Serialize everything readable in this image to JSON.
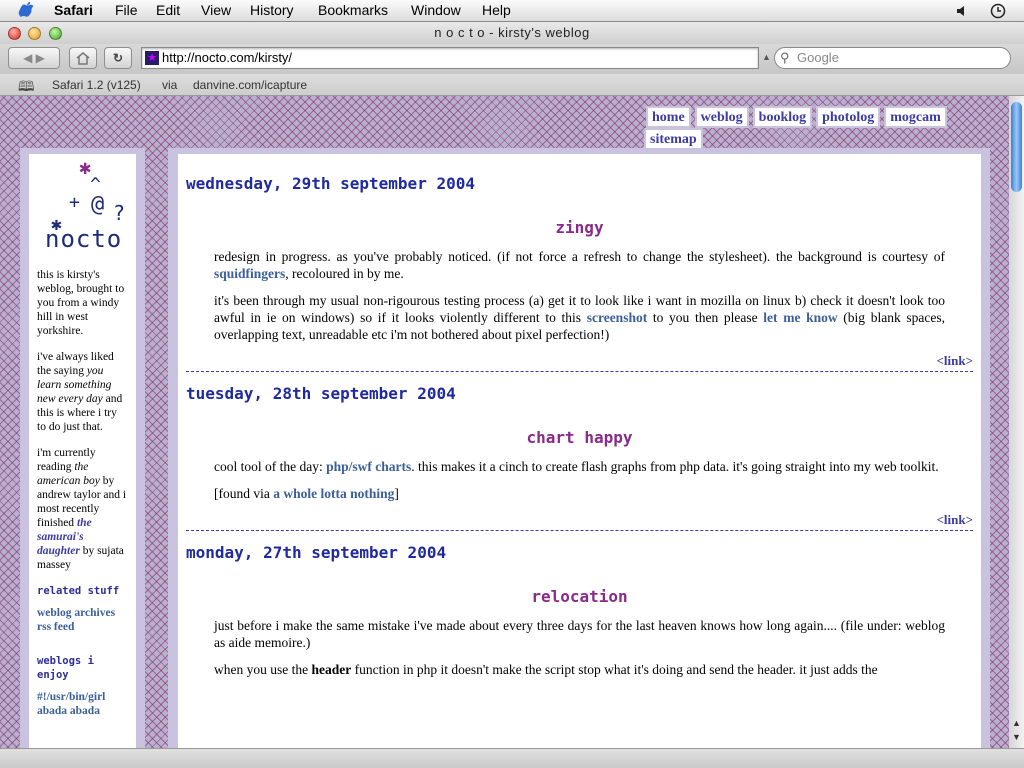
{
  "menubar": {
    "items": [
      "Safari",
      "File",
      "Edit",
      "View",
      "History",
      "Bookmarks",
      "Window",
      "Help"
    ]
  },
  "window": {
    "title": "n o c t o - kirsty's weblog"
  },
  "toolbar": {
    "url": "http://nocto.com/kirsty/",
    "search_placeholder": "Google"
  },
  "bookmarks": {
    "items": [
      "Safari 1.2 (v125)",
      "via",
      "danvine.com/icapture"
    ]
  },
  "nav": {
    "items": [
      "home",
      "weblog",
      "booklog",
      "photolog",
      "mogcam",
      "sitemap"
    ]
  },
  "logo": {
    "text": "nocto"
  },
  "sidebar": {
    "intro": "this is kirsty's weblog, brought to you from a windy hill in west yorkshire.",
    "saying_pre": "i've always liked the saying ",
    "saying_em": "you learn something new every day",
    "saying_post": " and this is where i try to do just that.",
    "reading_pre": "i'm currently reading ",
    "reading_book1": "the american boy",
    "reading_mid": " by andrew taylor and i most recently finished ",
    "reading_book2": "the samurai's daughter",
    "reading_post": " by sujata massey",
    "related_heading": "related stuff",
    "related_links": [
      "weblog archives",
      "rss feed"
    ],
    "weblogs_heading": "weblogs i enjoy",
    "weblogs_links": [
      "#!/usr/bin/girl",
      "abada abada"
    ]
  },
  "posts": [
    {
      "date": "wednesday, 29th september 2004",
      "title": "zingy",
      "p1_pre": "redesign in progress. as you've probably noticed. (if not force a refresh to change the stylesheet). the background is courtesy of ",
      "p1_link": "squidfingers",
      "p1_post": ", recoloured in by me.",
      "p2_pre": "it's been through my usual non-rigourous testing process (a) get it to look like i want in mozilla on linux b) check it doesn't look too awful in ie on windows) so if it looks violently different to this ",
      "p2_link1": "screenshot",
      "p2_mid": " to you then please ",
      "p2_link2": "let me know",
      "p2_post": " (big blank spaces, overlapping text, unreadable etc i'm not bothered about pixel perfection!)",
      "permalink": "<link>"
    },
    {
      "date": "tuesday, 28th september 2004",
      "title": "chart happy",
      "p1_pre": "cool tool of the day: ",
      "p1_link": "php/swf charts",
      "p1_post": ". this makes it a cinch to create flash graphs from php data. it's going straight into my web toolkit.",
      "p2_pre": "[found via ",
      "p2_link": "a whole lotta nothing",
      "p2_post": "]",
      "permalink": "<link>"
    },
    {
      "date": "monday, 27th september 2004",
      "title": "relocation",
      "p1": "just before i make the same mistake i've made about every three days for the last heaven knows how long again.... (file under: weblog as aide memoire.)",
      "p2_pre": "when you use the ",
      "p2_bold": "header",
      "p2_post": " function in php it doesn't make the script stop what it's doing and send the header. it just adds the"
    }
  ],
  "colors": {
    "accent": "#3b3ba3",
    "post_title": "#8a2a8a",
    "pattern": "#b9b0cf"
  }
}
